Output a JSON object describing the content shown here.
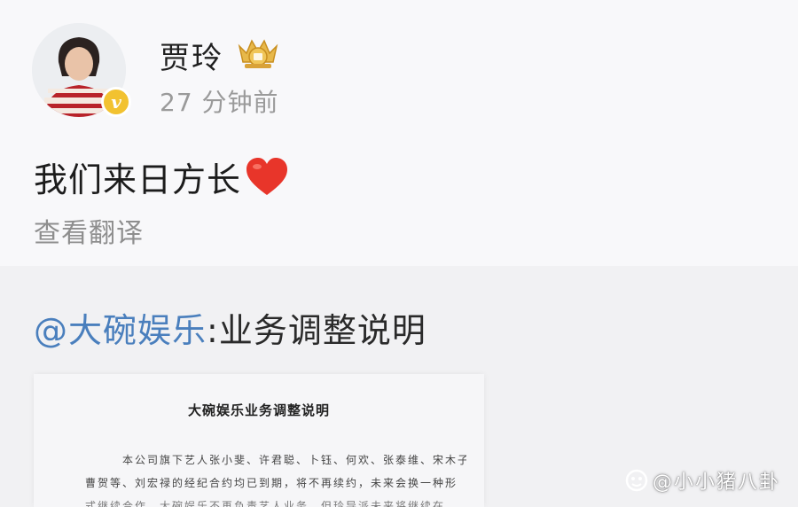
{
  "post": {
    "username": "贾玲",
    "time": "27 分钟前",
    "text": "我们来日方长",
    "translate_label": "查看翻译"
  },
  "repost": {
    "mention": "@大碗娱乐",
    "title": ":业务调整说明",
    "document": {
      "title": "大碗娱乐业务调整说明",
      "lines": [
        "本公司旗下艺人张小斐、许君聪、卜钰、何欢、张泰维、宋木子、",
        "曹贺等、刘宏禄的经纪合约均已到期，将不再续约，未来会换一种形",
        "式继续合作，大碗娱乐不再负责艺人业务，但玲导派未来将继续在"
      ]
    }
  },
  "watermark": {
    "text": "@小小猪八卦"
  },
  "colors": {
    "mention": "#4a7fbd",
    "verified": "#f2c230",
    "heart": "#e8352a"
  }
}
